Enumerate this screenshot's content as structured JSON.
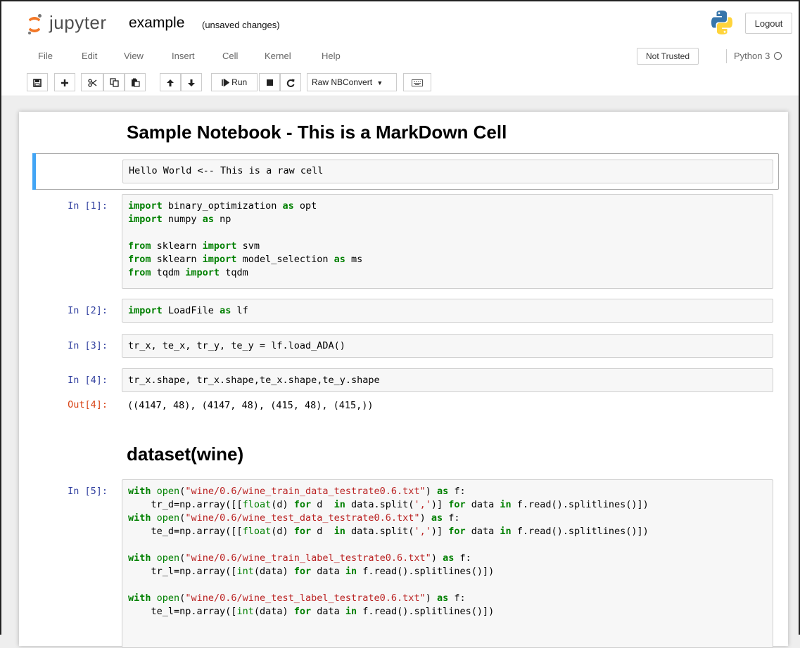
{
  "header": {
    "logo_text": "jupyter",
    "notebook_name": "example",
    "save_status": "(unsaved changes)",
    "logout_label": "Logout"
  },
  "menubar": {
    "items": [
      "File",
      "Edit",
      "View",
      "Insert",
      "Cell",
      "Kernel",
      "Help"
    ],
    "trusted_label": "Not Trusted",
    "kernel_name": "Python 3"
  },
  "toolbar": {
    "run_label": "Run",
    "cell_type": "Raw NBConvert",
    "icons": [
      "save-icon",
      "plus-icon",
      "cut-icon",
      "copy-icon",
      "paste-icon",
      "arrow-up-icon",
      "arrow-down-icon",
      "run-icon",
      "stop-icon",
      "restart-icon",
      "keyboard-icon"
    ]
  },
  "notebook": {
    "heading1": "Sample Notebook - This is a MarkDown Cell",
    "raw_cell": "Hello World <-- This is a raw cell",
    "cells": [
      {
        "prompt": "In [1]:",
        "code": "import binary_optimization as opt\nimport numpy as np\n\nfrom sklearn import svm\nfrom sklearn import model_selection as ms\nfrom tqdm import tqdm"
      },
      {
        "prompt": "In [2]:",
        "code": "import LoadFile as lf"
      },
      {
        "prompt": "In [3]:",
        "code": "tr_x, te_x, tr_y, te_y = lf.load_ADA()"
      },
      {
        "prompt": "In [4]:",
        "code": "tr_x.shape, tr_x.shape,te_x.shape,te_y.shape"
      },
      {
        "prompt": "In [5]:",
        "code": "with open(\"wine/0.6/wine_train_data_testrate0.6.txt\") as f:\n    tr_d=np.array([[float(d) for d  in data.split(',')] for data in f.read().splitlines()])\nwith open(\"wine/0.6/wine_test_data_testrate0.6.txt\") as f:\n    te_d=np.array([[float(d) for d  in data.split(',')] for data in f.read().splitlines()])\n\nwith open(\"wine/0.6/wine_train_label_testrate0.6.txt\") as f:\n    tr_l=np.array([int(data) for data in f.read().splitlines()])\n\nwith open(\"wine/0.6/wine_test_label_testrate0.6.txt\") as f:\n    te_l=np.array([int(data) for data in f.read().splitlines()])"
      }
    ],
    "output4": {
      "prompt": "Out[4]:",
      "text": "((4147, 48), (4147, 48), (415, 48), (415,))"
    },
    "heading2": "dataset(wine)"
  }
}
